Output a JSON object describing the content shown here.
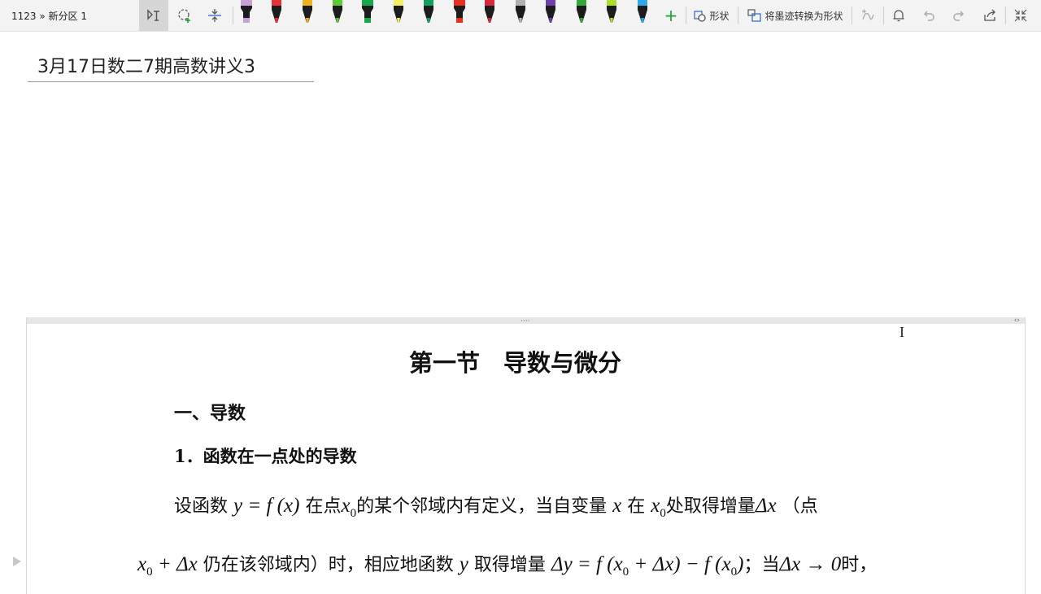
{
  "breadcrumb": {
    "notebook": "1123",
    "separator": "»",
    "section": "新分区 1"
  },
  "toolbar": {
    "pens": [
      {
        "icon": "highlighter-icon",
        "color": "#c8a0d8"
      },
      {
        "icon": "pen-icon",
        "color": "#e8303a"
      },
      {
        "icon": "pen-icon",
        "color": "#f0b020"
      },
      {
        "icon": "pen-icon",
        "color": "#5cc83c"
      },
      {
        "icon": "highlighter-icon",
        "color": "#18a84a"
      },
      {
        "icon": "pen-icon",
        "color": "#f6ee60"
      },
      {
        "icon": "pen-icon",
        "color": "#16a060"
      },
      {
        "icon": "highlighter-icon",
        "color": "#e83020"
      },
      {
        "icon": "pen-icon",
        "color": "#d8283a"
      },
      {
        "icon": "pen-icon",
        "color": "#b0b0b0"
      },
      {
        "icon": "pen-icon",
        "color": "#7040b0"
      },
      {
        "icon": "pen-icon",
        "color": "#34a838"
      },
      {
        "icon": "pen-icon",
        "color": "#a8e030"
      },
      {
        "icon": "pen-icon",
        "color": "#30a8e8"
      }
    ],
    "add_pen": "+",
    "shape_label": "形状",
    "ink_to_shape_label": "将墨迹转换为形状"
  },
  "page": {
    "title": "3月17日数二7期高数讲义3"
  },
  "document": {
    "section_title": "第一节　导数与微分",
    "heading1": "一、导数",
    "heading2": "1．函数在一点处的导数",
    "line1": {
      "t1": "设函数",
      "m1": "y = f (x)",
      "t2": "在点",
      "m2": "x",
      "m2sub": "0",
      "t3": "的某个邻域内有定义，当自变量",
      "m3": "x",
      "t4": "在",
      "m4": "x",
      "m4sub": "0",
      "t5": "处取得增量",
      "m5": "Δx",
      "t6": "（点"
    },
    "line2": {
      "m1": "x",
      "m1sub": "0",
      "m1b": " + Δx",
      "t1": "仍在该邻域内）时，相应地函数",
      "m2": "y",
      "t2": "取得增量",
      "m3": "Δy = f (x",
      "m3sub": "0",
      "m3b": " + Δx) − f (x",
      "m3sub2": "0",
      "m3c": ")",
      "t3": "；当",
      "m4": "Δx → 0",
      "t4": "时，"
    }
  }
}
